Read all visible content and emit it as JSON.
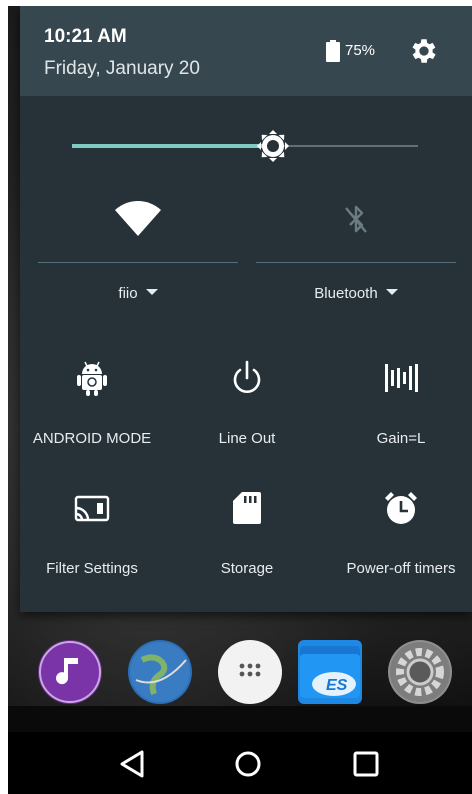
{
  "status": {
    "time": "10:21 AM",
    "date": "Friday, January 20",
    "battery_percent": "75%"
  },
  "brightness": {
    "level": 0.58
  },
  "toggles": [
    {
      "label": "fiio",
      "icon": "wifi-icon",
      "active": true
    },
    {
      "label": "Bluetooth",
      "icon": "bluetooth-disabled-icon",
      "active": false
    }
  ],
  "tiles": [
    {
      "label": "ANDROID MODE",
      "icon": "android-icon"
    },
    {
      "label": "Line Out",
      "icon": "power-line-out-icon"
    },
    {
      "label": "Gain=L",
      "icon": "gain-bars-icon"
    },
    {
      "label": "Filter Settings",
      "icon": "cast-filter-icon"
    },
    {
      "label": "Storage",
      "icon": "sd-card-icon"
    },
    {
      "label": "Power-off timers",
      "icon": "alarm-clock-icon"
    }
  ],
  "dock": [
    {
      "icon": "music-app-icon",
      "color": "#6a2c91"
    },
    {
      "icon": "browser-globe-icon",
      "color": "#2b6fb8"
    },
    {
      "icon": "app-drawer-icon",
      "color": "#f2f2f2"
    },
    {
      "icon": "es-file-explorer-icon",
      "color": "#1e88e5"
    },
    {
      "icon": "settings-app-icon",
      "color": "#8f8f8f"
    }
  ],
  "navigation": [
    "back-icon",
    "home-icon",
    "recents-icon"
  ],
  "colors": {
    "accent": "#80cbc4",
    "shade": "#263238",
    "header": "#37474f"
  }
}
